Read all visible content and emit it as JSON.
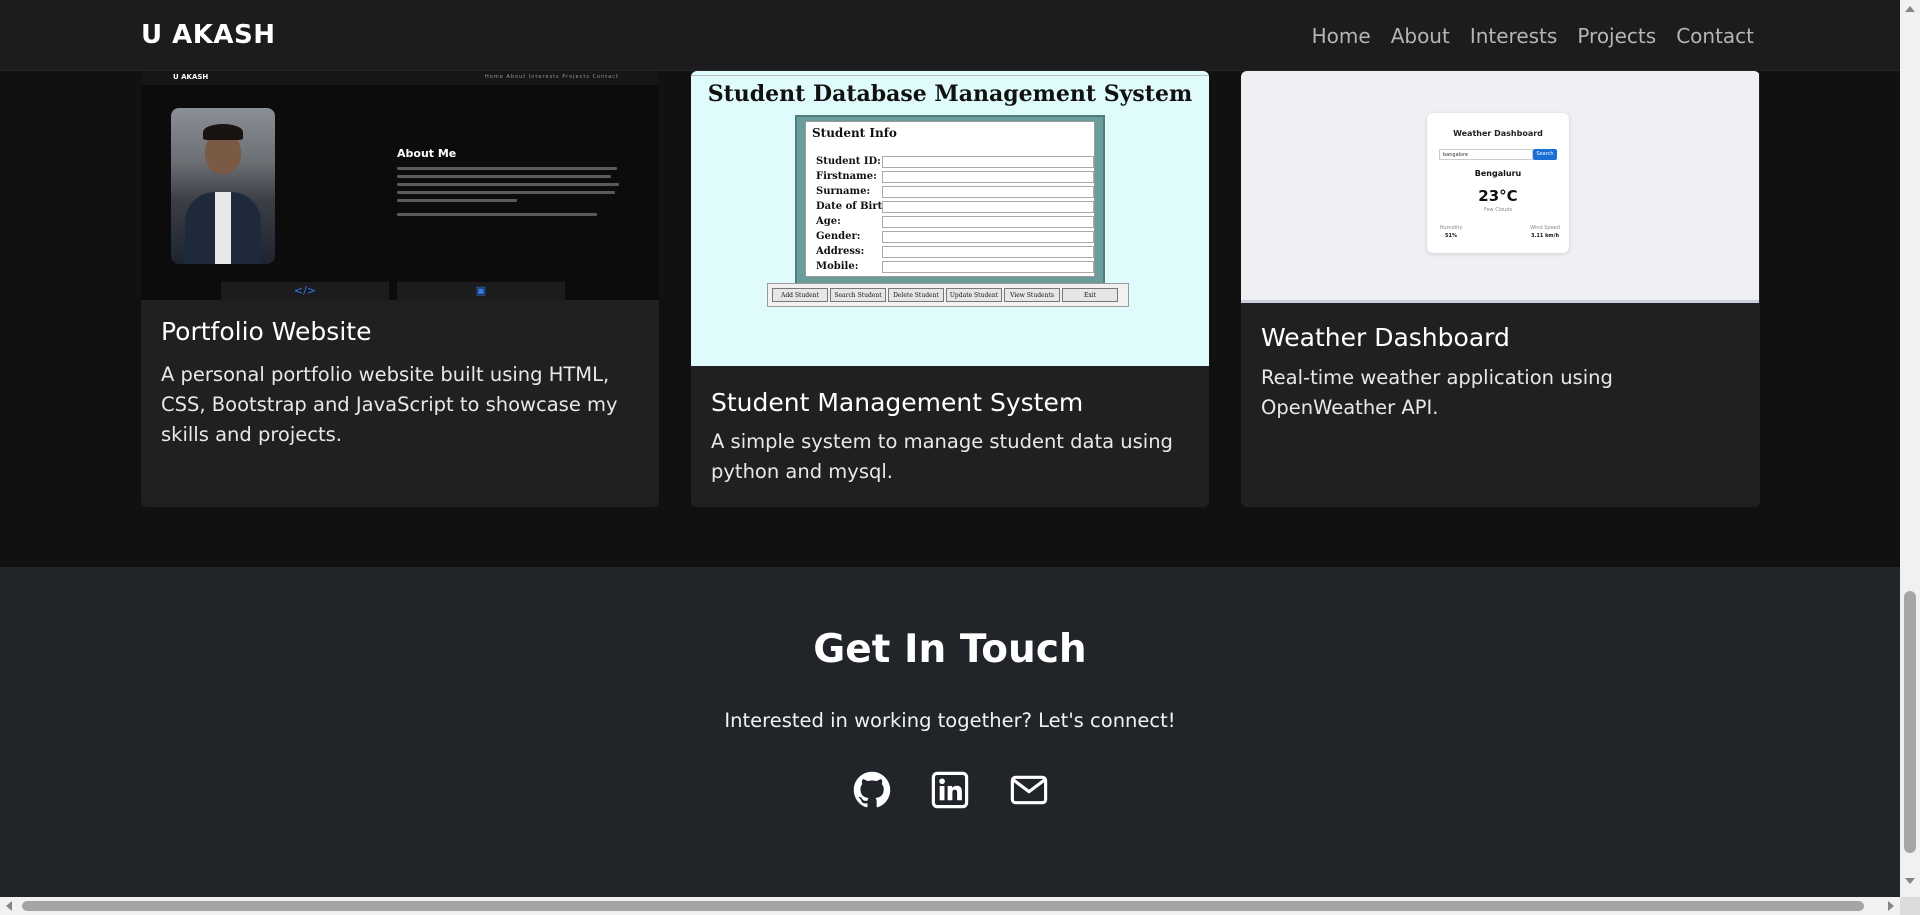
{
  "navbar": {
    "brand": "U AKASH",
    "links": [
      "Home",
      "About",
      "Interests",
      "Projects",
      "Contact"
    ]
  },
  "projects": [
    {
      "title": "Portfolio Website",
      "description": "A personal portfolio website built using HTML, CSS, Bootstrap and JavaScript to showcase my skills and projects.",
      "thumbnail": {
        "brand": "U AKASH",
        "nav": "Home  About  Interests  Projects  Contact",
        "heading": "About Me",
        "tab_icons": [
          "code-icon",
          "robot-icon"
        ]
      }
    },
    {
      "title": "Student Management System",
      "description": "A simple system to manage student data using python and mysql.",
      "thumbnail": {
        "heading": "Student Database Management System",
        "panel_title": "Student Info",
        "fields": [
          "Student ID:",
          "Firstname:",
          "Surname:",
          "Date of Birth:",
          "Age:",
          "Gender:",
          "Address:",
          "Mobile:"
        ],
        "buttons": [
          "Add Student",
          "Search Student",
          "Delete Student",
          "Update Student",
          "View Students",
          "Exit"
        ]
      }
    },
    {
      "title": "Weather Dashboard",
      "description": "Real-time weather application using OpenWeather API.",
      "thumbnail": {
        "heading": "Weather Dashboard",
        "search_value": "bangalore",
        "search_button": "Search",
        "city": "Bengaluru",
        "temperature": "23°C",
        "condition": "Few Clouds",
        "humidity_label": "Humidity",
        "humidity_value": "51%",
        "wind_label": "Wind Speed",
        "wind_value": "3.11 km/h"
      }
    }
  ],
  "contact": {
    "title": "Get In Touch",
    "subtitle": "Interested in working together? Let's connect!",
    "icons": [
      "github-icon",
      "linkedin-icon",
      "email-icon"
    ]
  },
  "colors": {
    "navbar_bg": "#1c1c1e",
    "page_bg": "#111111",
    "card_bg": "#202023",
    "contact_bg": "#212428",
    "accent": "#2f7ae5"
  }
}
